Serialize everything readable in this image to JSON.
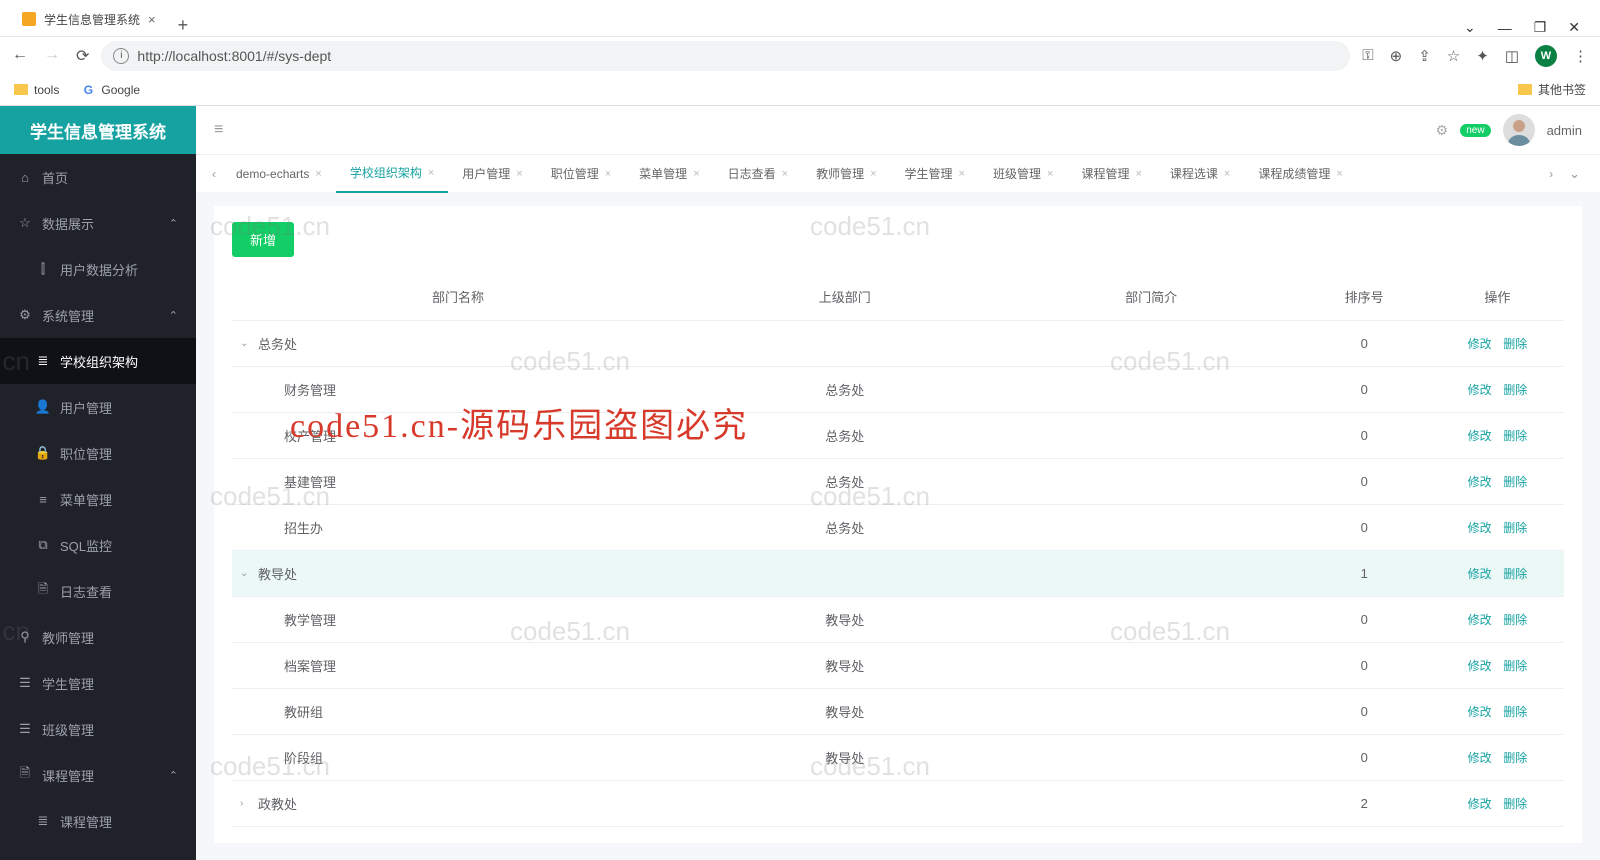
{
  "browser": {
    "tab_title": "学生信息管理系统",
    "url_display": "http://localhost:8001/#/sys-dept",
    "url_host_bold": "localhost",
    "new_tab_plus": "+",
    "profile_letter": "W",
    "bookmarks": {
      "tools": "tools",
      "google": "Google",
      "other": "其他书签"
    }
  },
  "app": {
    "logo": "学生信息管理系统",
    "user_name": "admin",
    "new_badge": "new",
    "add_button": "新增",
    "sidebar": [
      {
        "icon": "⌂",
        "label": "首页",
        "chev": ""
      },
      {
        "icon": "☆",
        "label": "数据展示",
        "chev": "⌃"
      },
      {
        "icon": "⫿",
        "label": "用户数据分析",
        "chev": "",
        "sub": true
      },
      {
        "icon": "⚙",
        "label": "系统管理",
        "chev": "⌃"
      },
      {
        "icon": "≣",
        "label": "学校组织架构",
        "chev": "",
        "sub": true,
        "active": true
      },
      {
        "icon": "👤",
        "label": "用户管理",
        "chev": "",
        "sub": true
      },
      {
        "icon": "🔒",
        "label": "职位管理",
        "chev": "",
        "sub": true
      },
      {
        "icon": "≡",
        "label": "菜单管理",
        "chev": "",
        "sub": true
      },
      {
        "icon": "⧉",
        "label": "SQL监控",
        "chev": "",
        "sub": true
      },
      {
        "icon": "🗎",
        "label": "日志查看",
        "chev": "",
        "sub": true
      },
      {
        "icon": "⚲",
        "label": "教师管理",
        "chev": ""
      },
      {
        "icon": "☰",
        "label": "学生管理",
        "chev": ""
      },
      {
        "icon": "☰",
        "label": "班级管理",
        "chev": ""
      },
      {
        "icon": "🗎",
        "label": "课程管理",
        "chev": "⌃"
      },
      {
        "icon": "≣",
        "label": "课程管理",
        "chev": "",
        "sub": true
      }
    ],
    "tabs": [
      {
        "label": "demo-echarts",
        "active": false
      },
      {
        "label": "学校组织架构",
        "active": true
      },
      {
        "label": "用户管理",
        "active": false
      },
      {
        "label": "职位管理",
        "active": false
      },
      {
        "label": "菜单管理",
        "active": false
      },
      {
        "label": "日志查看",
        "active": false
      },
      {
        "label": "教师管理",
        "active": false
      },
      {
        "label": "学生管理",
        "active": false
      },
      {
        "label": "班级管理",
        "active": false
      },
      {
        "label": "课程管理",
        "active": false
      },
      {
        "label": "课程选课",
        "active": false
      },
      {
        "label": "课程成绩管理",
        "active": false
      }
    ],
    "table": {
      "headers": {
        "name": "部门名称",
        "parent": "上级部门",
        "desc": "部门简介",
        "order": "排序号",
        "action": "操作"
      },
      "action_edit": "修改",
      "action_delete": "删除",
      "rows": [
        {
          "expand": "⌄",
          "indent": 0,
          "name": "总务处",
          "parent": "",
          "order": "0",
          "hover": false
        },
        {
          "expand": "",
          "indent": 1,
          "name": "财务管理",
          "parent": "总务处",
          "order": "0",
          "hover": false
        },
        {
          "expand": "",
          "indent": 1,
          "name": "校产管理",
          "parent": "总务处",
          "order": "0",
          "hover": false
        },
        {
          "expand": "",
          "indent": 1,
          "name": "基建管理",
          "parent": "总务处",
          "order": "0",
          "hover": false
        },
        {
          "expand": "",
          "indent": 1,
          "name": "招生办",
          "parent": "总务处",
          "order": "0",
          "hover": false
        },
        {
          "expand": "⌄",
          "indent": 0,
          "name": "教导处",
          "parent": "",
          "order": "1",
          "hover": true
        },
        {
          "expand": "",
          "indent": 1,
          "name": "教学管理",
          "parent": "教导处",
          "order": "0",
          "hover": false
        },
        {
          "expand": "",
          "indent": 1,
          "name": "档案管理",
          "parent": "教导处",
          "order": "0",
          "hover": false
        },
        {
          "expand": "",
          "indent": 1,
          "name": "教研组",
          "parent": "教导处",
          "order": "0",
          "hover": false
        },
        {
          "expand": "",
          "indent": 1,
          "name": "阶段组",
          "parent": "教导处",
          "order": "0",
          "hover": false
        },
        {
          "expand": "›",
          "indent": 0,
          "name": "政教处",
          "parent": "",
          "order": "2",
          "hover": false
        }
      ]
    }
  },
  "watermark": {
    "small": "code51.cn",
    "big": "code51.cn-源码乐园盗图必究"
  }
}
